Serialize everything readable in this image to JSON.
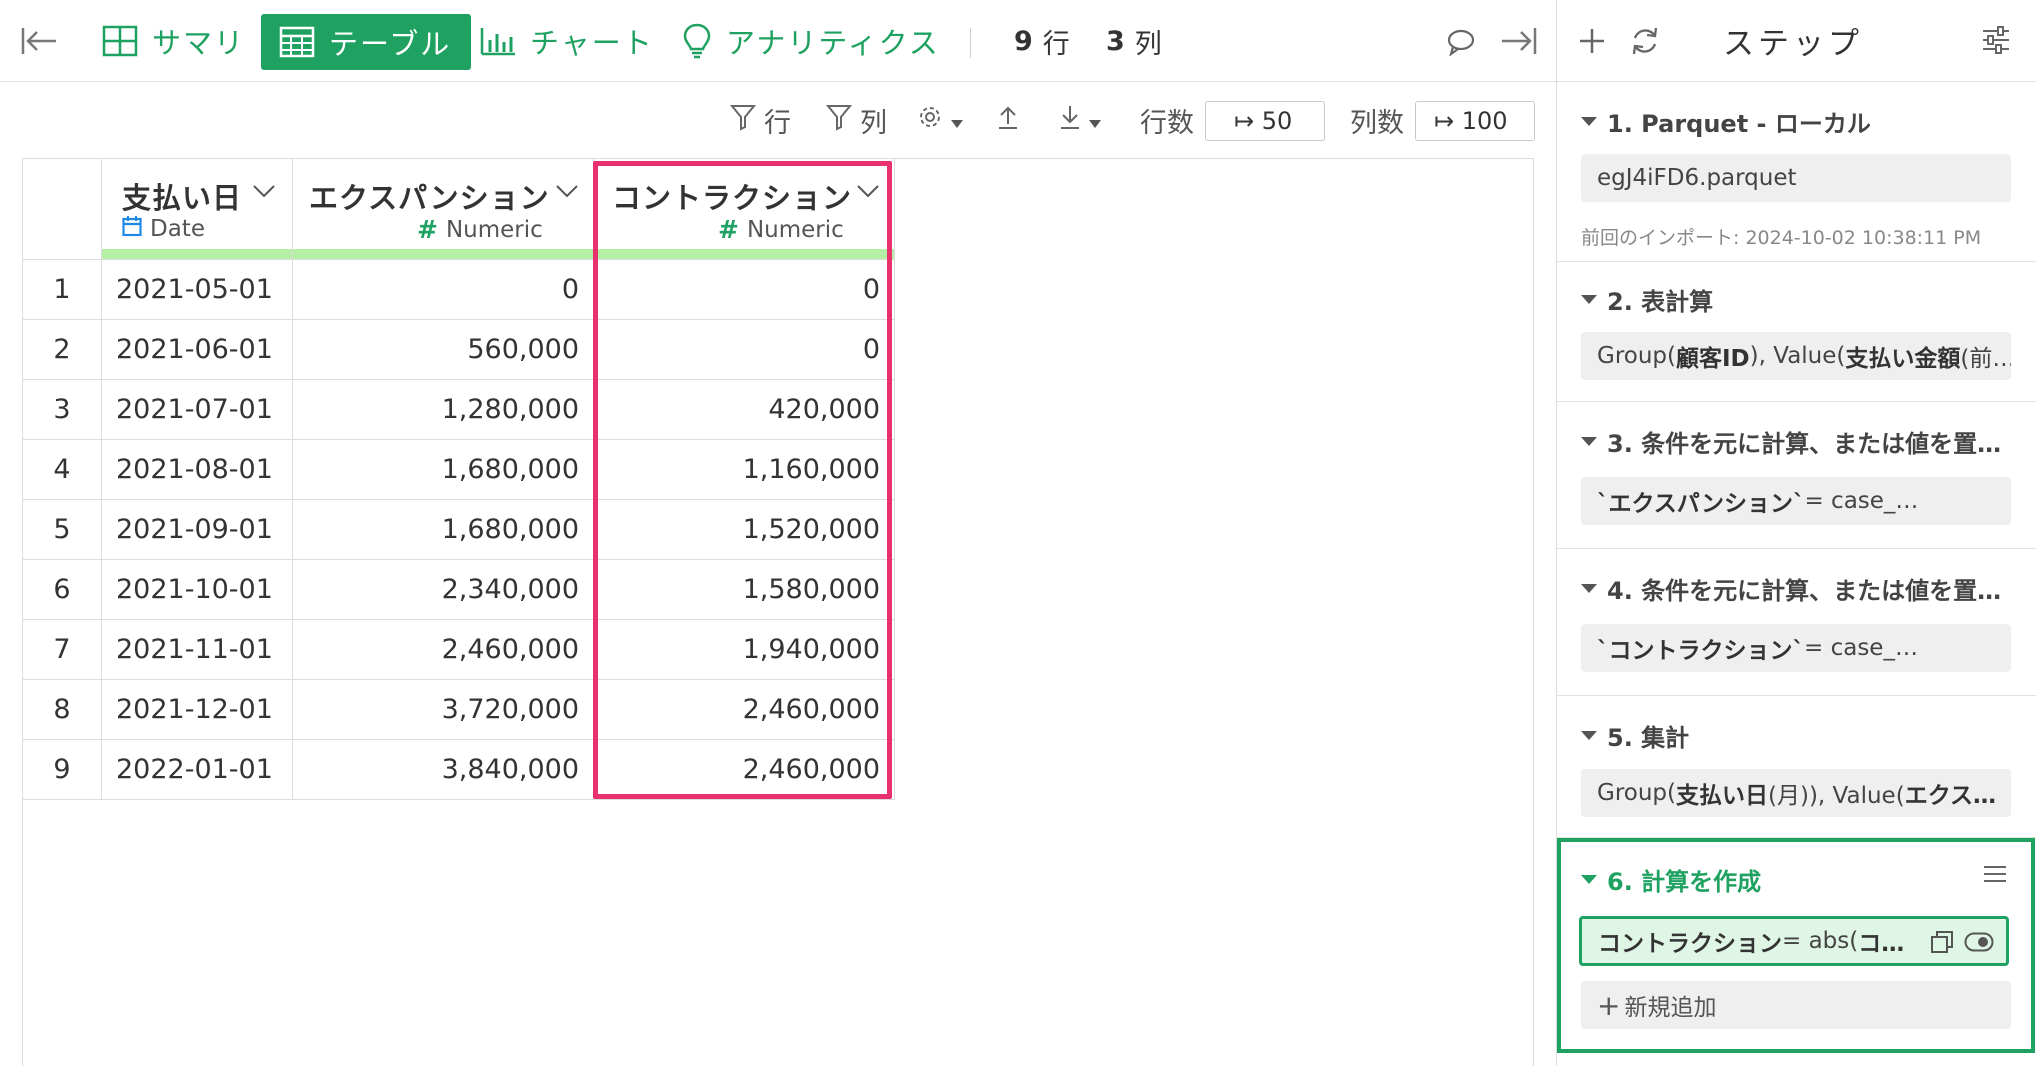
{
  "toolbar": {
    "summary_label": "サマリ",
    "table_label": "テーブル",
    "chart_label": "チャート",
    "analytics_label": "アナリティクス",
    "row_count": "9",
    "row_unit": "行",
    "col_count": "3",
    "col_unit": "列"
  },
  "subbar": {
    "row_filter_label": "行",
    "col_filter_label": "列",
    "rowcount_label": "行数",
    "rowcount_value": "↦ 50",
    "colcount_label": "列数",
    "colcount_value": "↦ 100"
  },
  "table": {
    "columns": [
      {
        "name": "支払い日",
        "type": "Date"
      },
      {
        "name": "エクスパンション",
        "type": "Numeric"
      },
      {
        "name": "コントラクション",
        "type": "Numeric"
      }
    ],
    "rows": [
      {
        "n": "1",
        "date": "2021-05-01",
        "expansion": "0",
        "contraction": "0"
      },
      {
        "n": "2",
        "date": "2021-06-01",
        "expansion": "560,000",
        "contraction": "0"
      },
      {
        "n": "3",
        "date": "2021-07-01",
        "expansion": "1,280,000",
        "contraction": "420,000"
      },
      {
        "n": "4",
        "date": "2021-08-01",
        "expansion": "1,680,000",
        "contraction": "1,160,000"
      },
      {
        "n": "5",
        "date": "2021-09-01",
        "expansion": "1,680,000",
        "contraction": "1,520,000"
      },
      {
        "n": "6",
        "date": "2021-10-01",
        "expansion": "2,340,000",
        "contraction": "1,580,000"
      },
      {
        "n": "7",
        "date": "2021-11-01",
        "expansion": "2,460,000",
        "contraction": "1,940,000"
      },
      {
        "n": "8",
        "date": "2021-12-01",
        "expansion": "3,720,000",
        "contraction": "2,460,000"
      },
      {
        "n": "9",
        "date": "2022-01-01",
        "expansion": "3,840,000",
        "contraction": "2,460,000"
      }
    ]
  },
  "steps_panel": {
    "title": "ステップ",
    "steps": [
      {
        "title": "1. Parquet - ローカル",
        "body": "egJ4iFD6.parquet",
        "meta": "前回のインポート: 2024-10-02 10:38:11 PM"
      },
      {
        "title": "2. 表計算",
        "body_a": "Group(",
        "body_b": "顧客ID",
        "body_c": "), Value(",
        "body_d": "支払い金額",
        "body_e": " (前…"
      },
      {
        "title": "3. 条件を元に計算、または値を置…",
        "body_a": "`エクスパンション`",
        "body_b": " = case_…"
      },
      {
        "title": "4. 条件を元に計算、または値を置…",
        "body_a": "`コントラクション`",
        "body_b": " = case_…"
      },
      {
        "title": "5. 集計",
        "body_a": "Group(",
        "body_b": "支払い日",
        "body_c": " (月)), Value(",
        "body_d": "エクス…"
      },
      {
        "title": "6. 計算を作成",
        "body_a": "コントラクション",
        "body_b": " = abs(",
        "body_c": "コ…",
        "add_label": "新規追加"
      }
    ]
  },
  "colors": {
    "accent": "#1fa261",
    "highlight": "#e8316d",
    "type_bar": "#b6f0a6"
  }
}
